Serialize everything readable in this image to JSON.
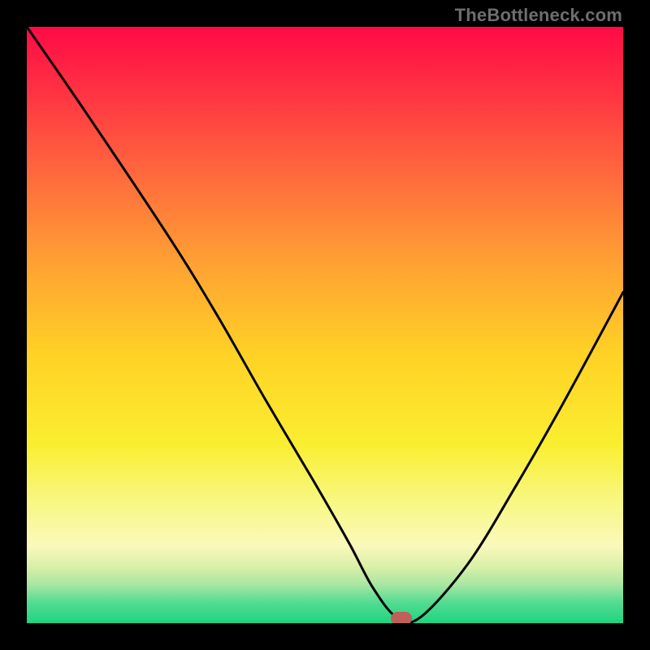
{
  "attribution": "TheBottleneck.com",
  "marker": {
    "color": "#c06058",
    "x_pct": 62.8,
    "y_pct": 99.2
  },
  "gradient_stops": [
    {
      "offset": 0.0,
      "color": "#ff0a46"
    },
    {
      "offset": 0.1,
      "color": "#ff2f43"
    },
    {
      "offset": 0.25,
      "color": "#ff6a3d"
    },
    {
      "offset": 0.4,
      "color": "#ffa233"
    },
    {
      "offset": 0.55,
      "color": "#ffd225"
    },
    {
      "offset": 0.7,
      "color": "#faee30"
    },
    {
      "offset": 0.8,
      "color": "#f8f885"
    },
    {
      "offset": 0.87,
      "color": "#faf9bc"
    },
    {
      "offset": 0.905,
      "color": "#d9f0a8"
    },
    {
      "offset": 0.935,
      "color": "#a9e6a2"
    },
    {
      "offset": 0.965,
      "color": "#53dc92"
    },
    {
      "offset": 1.0,
      "color": "#1ed481"
    }
  ],
  "chart_data": {
    "type": "line",
    "title": "",
    "xlabel": "",
    "ylabel": "",
    "xlim": [
      0,
      100
    ],
    "ylim": [
      0,
      100
    ],
    "series": [
      {
        "name": "bottleneck-curve",
        "x": [
          0,
          10,
          24,
          32,
          40,
          48,
          54,
          58,
          62,
          66,
          74,
          82,
          90,
          100
        ],
        "y": [
          100,
          85.5,
          64.5,
          51.5,
          37.5,
          24.0,
          13.5,
          6.0,
          1.0,
          1.0,
          10.0,
          23.0,
          37.0,
          55.5
        ]
      }
    ],
    "marker_point": {
      "x": 62.8,
      "y": 0.8
    }
  }
}
